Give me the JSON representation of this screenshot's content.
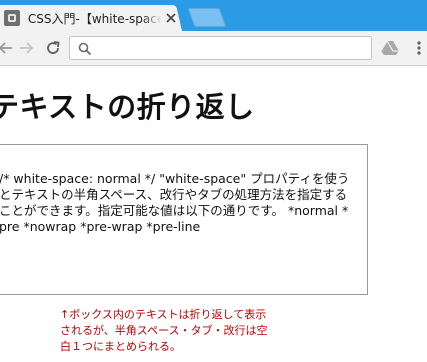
{
  "browser": {
    "tab_title": "CSS入門-【white-space】テキストの折り返し",
    "address_value": "",
    "address_placeholder": ""
  },
  "page": {
    "heading": "テキストの折り返し",
    "demo_text": "/* white-space: normal */\n\n \"white-space\" プロパティを使うとテキストの半角スペース、改行やタブの処理方法を指定することができます。指定可能な値は以下の通りです。 *normal * pre *nowrap *pre-wrap *pre-line",
    "note": "↑ボックス内のテキストは折り返して表示されるが、半角スペース・タブ・改行は空白１つにまとめられる。"
  },
  "colors": {
    "tabstrip": "#2b9be6",
    "toolbar": "#f2f2f2",
    "note_text": "#c00000"
  },
  "icons": [
    "favicon",
    "close-icon",
    "back-arrow-icon",
    "forward-arrow-icon",
    "reload-icon",
    "search-icon",
    "extension-icon",
    "menu-icon"
  ]
}
